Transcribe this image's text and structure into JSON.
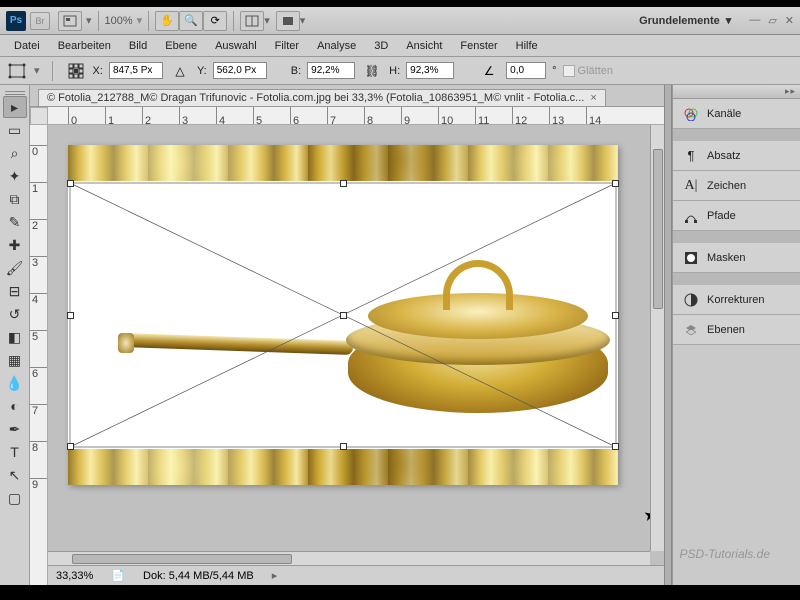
{
  "titlebar": {
    "ps_logo": "Ps",
    "br_logo": "Br",
    "zoom": "100%",
    "workspace": "Grundelemente"
  },
  "menu": {
    "items": [
      "Datei",
      "Bearbeiten",
      "Bild",
      "Ebene",
      "Auswahl",
      "Filter",
      "Analyse",
      "3D",
      "Ansicht",
      "Fenster",
      "Hilfe"
    ]
  },
  "options": {
    "x_label": "X:",
    "x_value": "847,5 Px",
    "y_label": "Y:",
    "y_value": "562,0 Px",
    "w_label": "B:",
    "w_value": "92,2%",
    "h_label": "H:",
    "h_value": "92,3%",
    "angle_label": "",
    "angle_value": "0,0",
    "angle_unit": "°",
    "smooth_label": "Glätten"
  },
  "doctab": {
    "title": "© Fotolia_212788_M© Dragan Trifunovic - Fotolia.com.jpg bei 33,3% (Fotolia_10863951_M© vnlit - Fotolia.c...",
    "close": "×"
  },
  "hruler_ticks": [
    "0",
    "1",
    "2",
    "3",
    "4",
    "5",
    "6",
    "7",
    "8",
    "9",
    "10",
    "11",
    "12",
    "13",
    "14"
  ],
  "vruler_ticks": [
    "0",
    "1",
    "2",
    "3",
    "4",
    "5",
    "6",
    "7",
    "8",
    "9"
  ],
  "status": {
    "zoom": "33,33%",
    "doc_size_label": "Dok:",
    "doc_size": "5,44 MB/5,44 MB"
  },
  "panels": {
    "items": [
      {
        "icon": "channels",
        "label": "Kanäle"
      },
      {
        "icon": "paragraph",
        "label": "Absatz"
      },
      {
        "icon": "character",
        "label": "Zeichen"
      },
      {
        "icon": "paths",
        "label": "Pfade"
      },
      {
        "icon": "masks",
        "label": "Masken"
      },
      {
        "icon": "adjustments",
        "label": "Korrekturen"
      },
      {
        "icon": "layers",
        "label": "Ebenen"
      }
    ]
  },
  "watermark": "PSD-Tutorials.de"
}
